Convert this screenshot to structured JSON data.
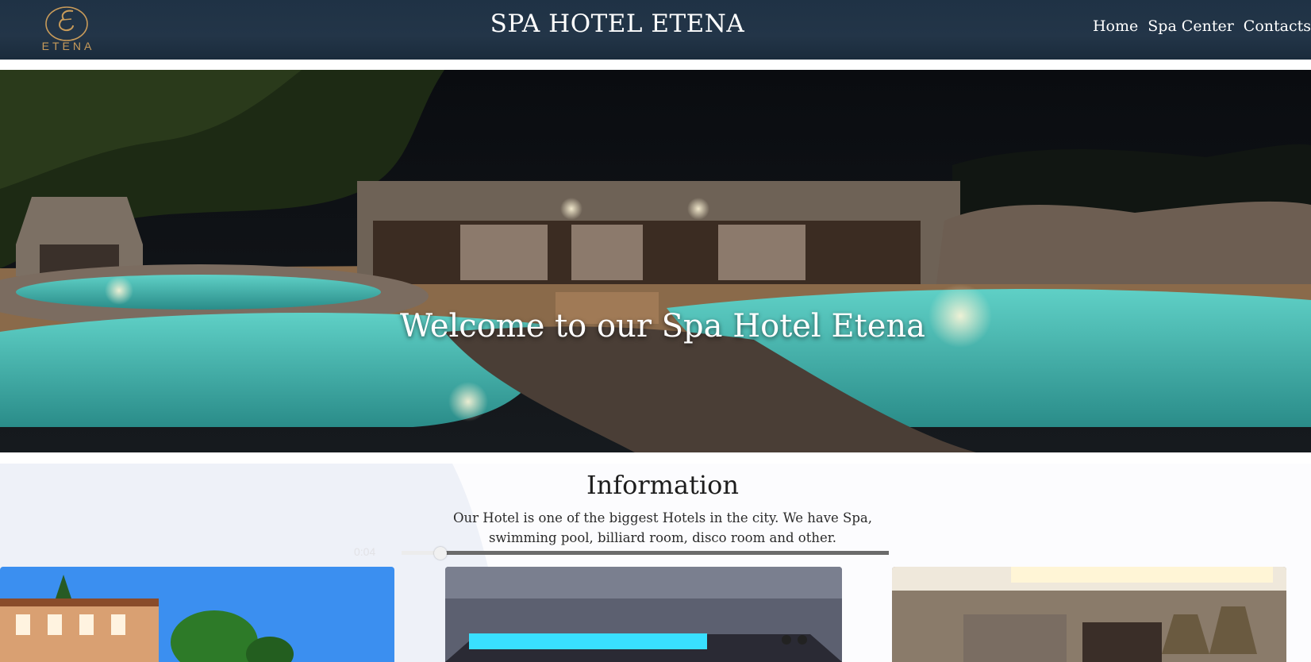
{
  "header": {
    "logo_text": "ETENA",
    "title": "SPA HOTEL ETENA",
    "nav": [
      {
        "label": "Home"
      },
      {
        "label": "Spa Center"
      },
      {
        "label": "Contacts"
      }
    ]
  },
  "hero": {
    "heading": "Welcome to our Spa Hotel Etena"
  },
  "info": {
    "title": "Information",
    "text": "Our Hotel is one of the biggest Hotels in the city. We have Spa, swimming pool, billiard room, disco room and other."
  },
  "player": {
    "time": "0:04",
    "progress_fraction": 0.08
  },
  "cards": [
    {
      "name": "hotel-exterior-photo"
    },
    {
      "name": "disco-room-photo"
    },
    {
      "name": "billiard-room-photo"
    }
  ],
  "colors": {
    "header_bg": "#1f3245",
    "logo_gold": "#c89b5a",
    "pool_water": "#3fb7b0"
  }
}
